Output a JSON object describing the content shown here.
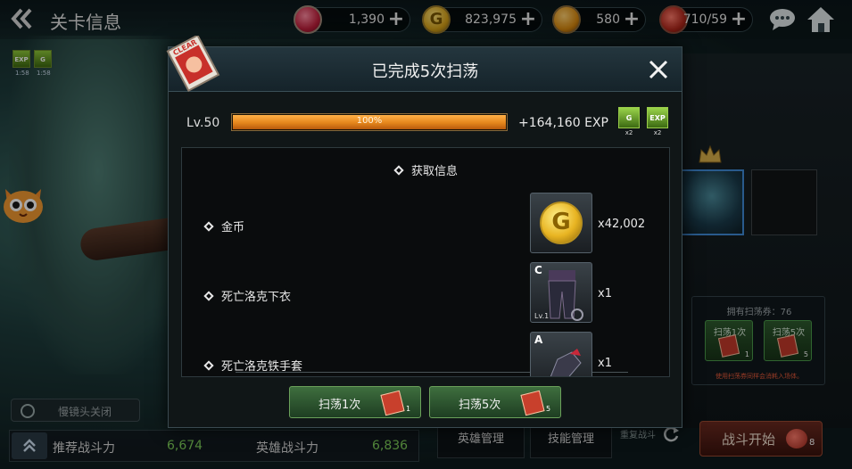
{
  "header": {
    "back_icon": "double-chevron-left-icon",
    "title": "关卡信息",
    "resources": [
      {
        "icon": "ruby-icon",
        "value": "1,390",
        "add": "+"
      },
      {
        "icon": "gold-coin-icon",
        "value": "823,975",
        "add": "+"
      },
      {
        "icon": "amber-crystal-icon",
        "value": "580",
        "add": "+"
      },
      {
        "icon": "stamina-meat-icon",
        "value": "710/59",
        "add": "+"
      }
    ],
    "gold_symbol": "G"
  },
  "buffs": [
    {
      "label": "EXP",
      "time": "1:58"
    },
    {
      "label": "G",
      "time": "1:58"
    }
  ],
  "camera_toggle": "慢镜头关闭",
  "power": {
    "recommended_label": "推荐战斗力",
    "recommended_value": "6,674",
    "hero_label": "英雄战斗力",
    "hero_value": "6,836"
  },
  "right_panel": {
    "tickets_label": "拥有扫荡券：76",
    "sweep1": {
      "label": "扫荡1次",
      "count": "1"
    },
    "sweep5": {
      "label": "扫荡5次",
      "count": "5"
    },
    "warning": "使用扫荡券同样会消耗入场体。",
    "hero_manage": "英雄管理",
    "skill_manage": "技能管理",
    "repeat_battle": "重复战斗",
    "start": "战斗开始",
    "start_cost": "8"
  },
  "modal": {
    "badge_text": "CLEAR",
    "title": "已完成5次扫荡",
    "level": "Lv.50",
    "exp_progress": 100,
    "exp_percent_text": "100%",
    "exp_gain": "+164,160 EXP",
    "boosts": [
      {
        "label": "G",
        "mult": "x2"
      },
      {
        "label": "EXP",
        "mult": "x2"
      }
    ],
    "info_title": "获取信息",
    "rewards": [
      {
        "name": "金币",
        "qty": "x42,002",
        "coin": "G"
      },
      {
        "name": "死亡洛克下衣",
        "qty": "x1",
        "grade": "C",
        "lv": "Lv.1"
      },
      {
        "name": "死亡洛克铁手套",
        "qty": "x1",
        "grade": "A"
      }
    ],
    "buttons": [
      {
        "label": "扫荡1次",
        "count": "1"
      },
      {
        "label": "扫荡5次",
        "count": "5"
      }
    ]
  },
  "colors": {
    "accent_green": "#7fd05a",
    "exp_orange": "#e5861c",
    "warning_red": "#e85a3a"
  }
}
